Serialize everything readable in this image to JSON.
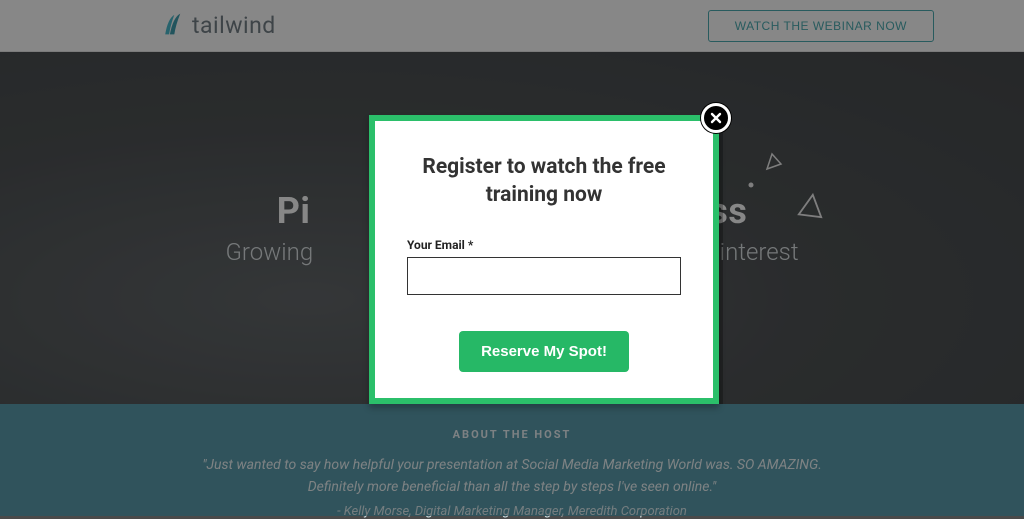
{
  "header": {
    "brand": "tailwind",
    "webinar_button": "WATCH THE WEBINAR NOW"
  },
  "hero": {
    "title_left": "Pi",
    "title_right": "ss",
    "subtitle_left": "Growing",
    "subtitle_right": "Pinterest"
  },
  "testimonial": {
    "heading": "ABOUT THE HOST",
    "quote": "\"Just wanted to say how helpful your presentation at Social Media Marketing World was. SO AMAZING. Definitely more beneficial than all the step by steps I've seen online.\"",
    "attribution": "- Kelly Morse, Digital Marketing Manager, Meredith Corporation"
  },
  "modal": {
    "title": "Register to watch the free training now",
    "email_label": "Your Email *",
    "submit_label": "Reserve My Spot!"
  }
}
